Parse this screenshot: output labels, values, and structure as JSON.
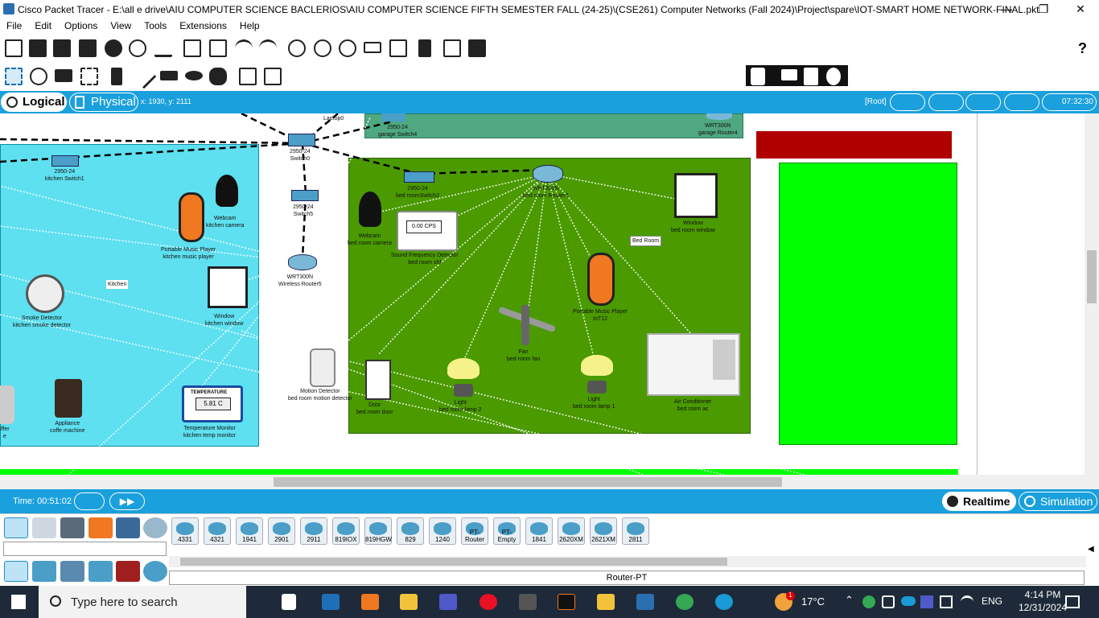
{
  "window": {
    "title": "Cisco Packet Tracer - E:\\all e drive\\AIU COMPUTER SCIENCE BACLERIOS\\AIU COMPUTER SCIENCE FIFTH SEMESTER FALL (24-25)\\(CSE261) Computer Networks (Fall 2024)\\Project\\spare\\IOT-SMART HOME NETWORK-FINAL.pkt",
    "minimize": "—",
    "restore": "❐",
    "close": "✕"
  },
  "menu": [
    "File",
    "Edit",
    "Options",
    "View",
    "Tools",
    "Extensions",
    "Help"
  ],
  "toolbar_help": "?",
  "modebar": {
    "logical": "Logical",
    "physical": "Physical",
    "coords": "x: 1930, y: 2111",
    "root": "[Root]",
    "clock": "07:32:30"
  },
  "canvas": {
    "rooms": {
      "kitchen": "Kitchen",
      "bedroom": "Bed Room"
    },
    "devices": {
      "laptop0": "Laptop0",
      "garage_switch": [
        "2950-24",
        "garage Switch4"
      ],
      "garage_router": [
        "WRT300N",
        "garage Router4"
      ],
      "switch0": [
        "2950-24",
        "Switch0"
      ],
      "kitchen_switch": [
        "2950-24",
        "kitchen Switch1"
      ],
      "switch5": [
        "2950-24",
        "Switch5"
      ],
      "wireless_router5": [
        "WRT300N",
        "Wireless Router5"
      ],
      "bedroom_switch": [
        "2950-24",
        "bed roomSwitch2"
      ],
      "bedroom_router": [
        "WRT300N",
        "bed room Router3"
      ],
      "kitchen_camera": [
        "Webcam",
        "kitchen camera"
      ],
      "kitchen_music": [
        "Portable Music Player",
        "kitchen music player"
      ],
      "kitchen_window": [
        "Window",
        "kitchen window"
      ],
      "smoke": [
        "Smoke Detector",
        "kitchen smoke detector"
      ],
      "coffee": [
        "Appliance",
        "coffe machine"
      ],
      "temp_monitor": [
        "Temperature Monitor",
        "kitchen temp monitor"
      ],
      "temp_reading": "5.81 C",
      "temp_header": "TEMPERATURE",
      "fridge": [
        "iffer",
        "e"
      ],
      "motion": [
        "Motion Detector",
        "bed room motion detector"
      ],
      "bedroom_camera": [
        "Webcam",
        "bed room camera"
      ],
      "sound_detector": [
        "Sound Frequency Detector",
        "bed room sfd"
      ],
      "sound_reading": "0.00 CPS",
      "bedroom_window": [
        "Window",
        "bed room window"
      ],
      "bedroom_music": [
        "Portable Music Player",
        "IoT12"
      ],
      "fan": [
        "Fan",
        "bed room fan"
      ],
      "lamp2": [
        "Light",
        "bed room lamp 2"
      ],
      "lamp1": [
        "Light",
        "bed room lamp 1"
      ],
      "door": [
        "Door",
        "bed room door"
      ],
      "ac": [
        "Air Conditioner",
        "bed room ac"
      ]
    }
  },
  "timebar": {
    "time": "Time: 00:51:02",
    "realtime": "Realtime",
    "simulation": "Simulation"
  },
  "device_models": [
    "4331",
    "4321",
    "1941",
    "2901",
    "2911",
    "819IOX",
    "819HGW",
    "829",
    "1240",
    "PT-Router",
    "PT-Empty",
    "1841",
    "2620XM",
    "2621XM",
    "2811"
  ],
  "selected_device": "Router-PT",
  "taskbar": {
    "search_placeholder": "Type here to search",
    "weather": "17°C",
    "lang": "ENG",
    "time": "4:14 PM",
    "date": "12/31/2024",
    "weather_badge": "1"
  },
  "colors": {
    "accent": "#1aa0dc",
    "bedroom_bg": "#4a9a00",
    "kitchen_bg": "#5ee0f0",
    "garage_bg": "#4fa880",
    "green_zone": "#00ff00",
    "red_block": "#b00000"
  }
}
